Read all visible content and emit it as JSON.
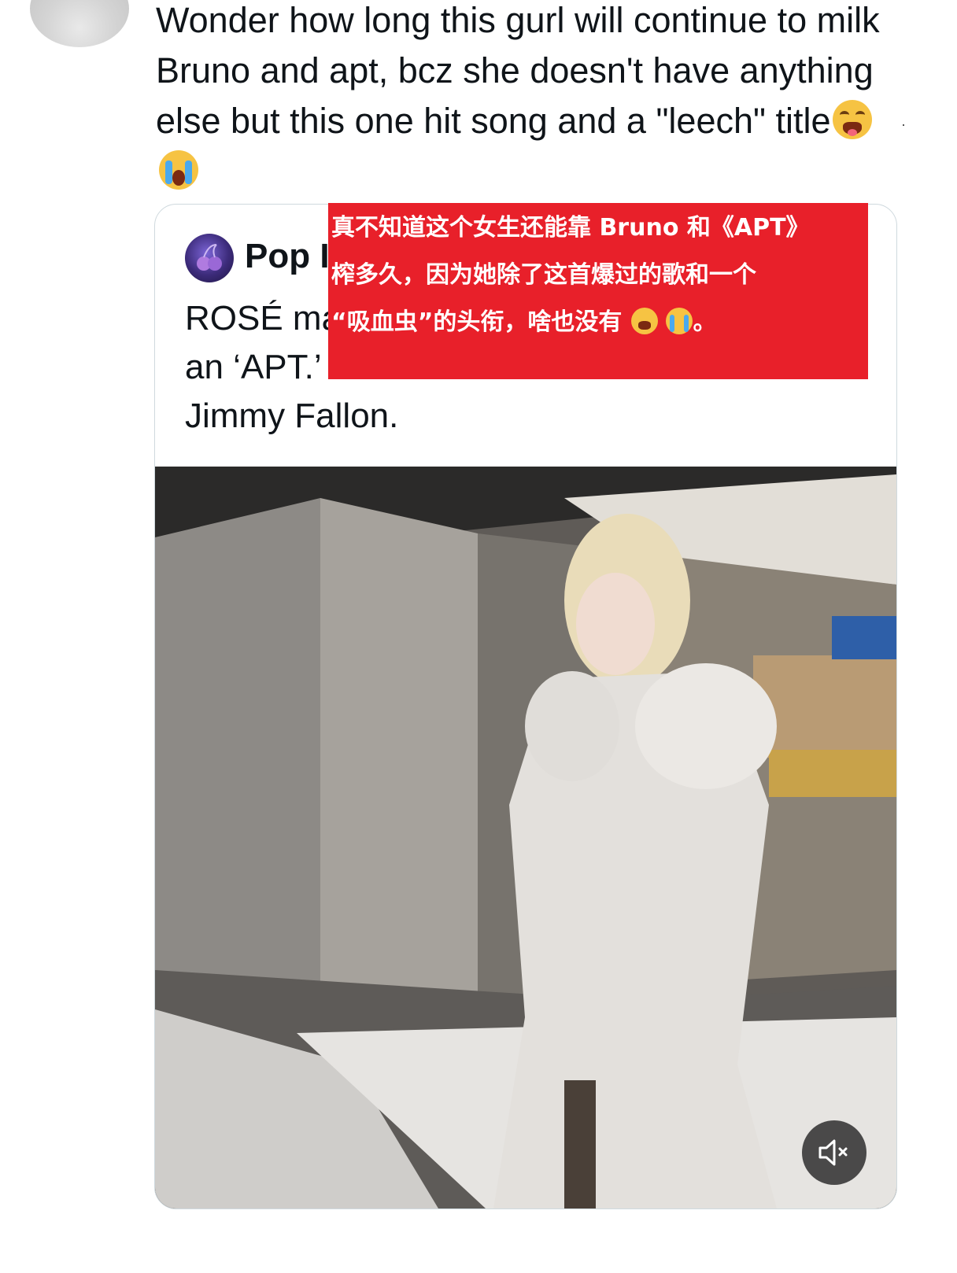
{
  "reply": {
    "text": "Wonder how long this gurl will continue to milk Bruno and apt, bcz she doesn't have anything else but this one hit song and a \"leech\" title",
    "emojis": [
      "weary-face",
      "loudly-crying-face"
    ]
  },
  "quoted_post": {
    "author_name_visible": "Pop I",
    "text": "ROSÉ ma",
    "text_line2": "an ‘APT.’",
    "text_line3": "Jimmy Fallon."
  },
  "translation_overlay": {
    "line1": "真不知道这个女生还能靠 Bruno 和《APT》",
    "line2": "榨多久，因为她除了这首爆过的歌和一个",
    "line3": "“吸血虫”的头衔，啥也没有",
    "line3_end": "。",
    "background_color": "#e8202a"
  },
  "video": {
    "muted": true,
    "mute_icon": "speaker-muted-icon"
  }
}
